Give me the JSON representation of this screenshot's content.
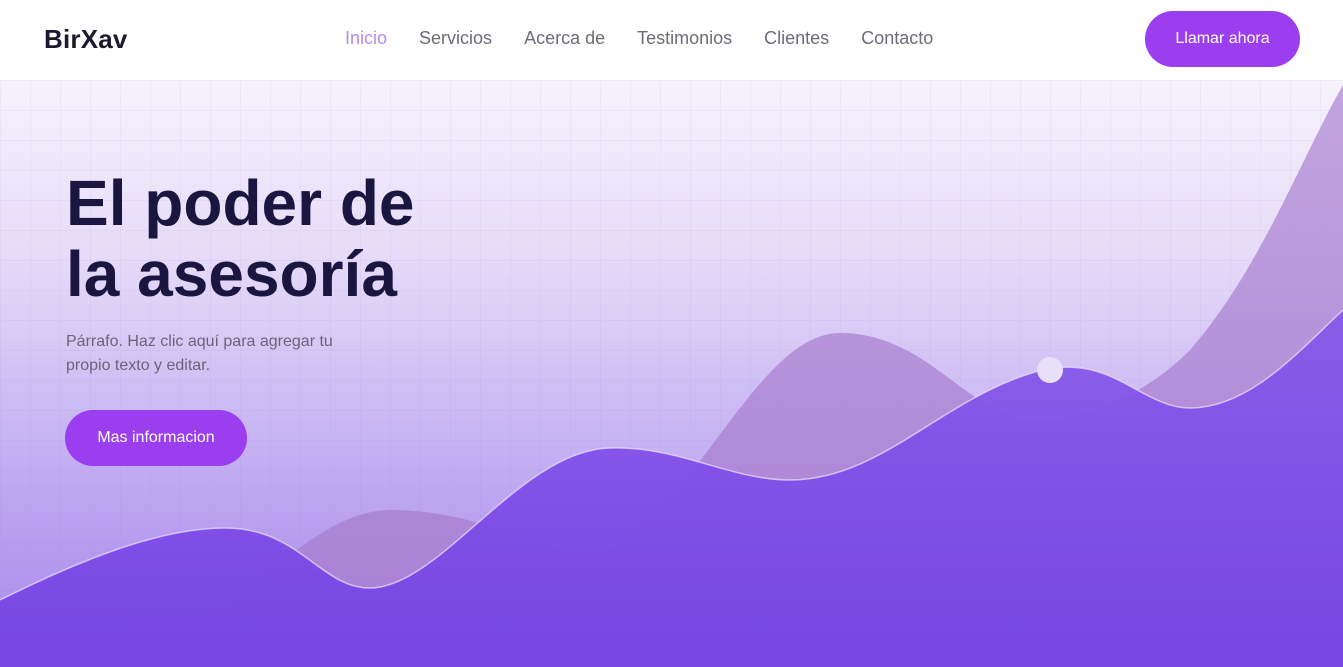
{
  "header": {
    "logo": "BirXav",
    "nav": [
      {
        "label": "Inicio",
        "active": true
      },
      {
        "label": "Servicios"
      },
      {
        "label": "Acerca de"
      },
      {
        "label": "Testimonios"
      },
      {
        "label": "Clientes"
      },
      {
        "label": "Contacto"
      }
    ],
    "cta_label": "Llamar ahora"
  },
  "hero": {
    "headline_line1": "El poder de",
    "headline_line2": "la asesoría",
    "paragraph": "Párrafo. Haz clic aquí para agregar tu propio texto y editar.",
    "cta_label": "Mas informacion"
  },
  "colors": {
    "accent": "#9b3ef0",
    "nav_active": "#b58be6",
    "heading": "#1b1640",
    "wave_front": "#7b4be6",
    "wave_back": "#b391d8"
  }
}
